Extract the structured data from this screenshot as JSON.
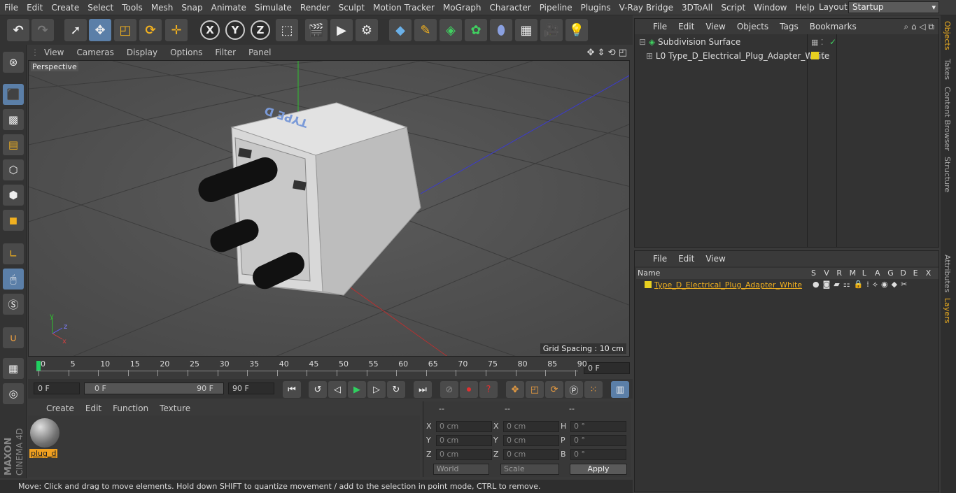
{
  "menubar": {
    "items": [
      "File",
      "Edit",
      "Create",
      "Select",
      "Tools",
      "Mesh",
      "Snap",
      "Animate",
      "Simulate",
      "Render",
      "Sculpt",
      "Motion Tracker",
      "MoGraph",
      "Character",
      "Pipeline",
      "Plugins",
      "V-Ray Bridge",
      "3DToAll",
      "Script",
      "Window",
      "Help"
    ],
    "layout_label": "Layout:",
    "layout_value": "Startup"
  },
  "toolbar": {
    "x_label": "X",
    "y_label": "Y",
    "z_label": "Z"
  },
  "viewport": {
    "menu": [
      "View",
      "Cameras",
      "Display",
      "Options",
      "Filter",
      "Panel"
    ],
    "camera_label": "Perspective",
    "grid_spacing": "Grid Spacing : 10 cm",
    "model_text": "TYPE D",
    "axis_x": "x",
    "axis_y": "y",
    "axis_z": "z"
  },
  "timeline": {
    "ticks": [
      "0",
      "5",
      "10",
      "15",
      "20",
      "25",
      "30",
      "35",
      "40",
      "45",
      "50",
      "55",
      "60",
      "65",
      "70",
      "75",
      "80",
      "85",
      "90"
    ],
    "current_frame": "0 F"
  },
  "transport": {
    "start": "0 F",
    "range_start": "0 F",
    "range_end": "90 F",
    "end": "90 F"
  },
  "material_manager": {
    "menu": [
      "Create",
      "Edit",
      "Function",
      "Texture"
    ],
    "material_name": "plug_d"
  },
  "coordinates": {
    "header": [
      "--",
      "--",
      "--"
    ],
    "rows": [
      {
        "l1": "X",
        "v1": "0 cm",
        "l2": "X",
        "v2": "0 cm",
        "l3": "H",
        "v3": "0 °"
      },
      {
        "l1": "Y",
        "v1": "0 cm",
        "l2": "Y",
        "v2": "0 cm",
        "l3": "P",
        "v3": "0 °"
      },
      {
        "l1": "Z",
        "v1": "0 cm",
        "l2": "Z",
        "v2": "0 cm",
        "l3": "B",
        "v3": "0 °"
      }
    ],
    "mode": "World",
    "scale": "Scale",
    "apply": "Apply"
  },
  "status": "Move: Click and drag to move elements. Hold down SHIFT to quantize movement / add to the selection in point mode, CTRL to remove.",
  "object_manager": {
    "menu": [
      "File",
      "Edit",
      "View",
      "Objects",
      "Tags",
      "Bookmarks"
    ],
    "objects": [
      "Subdivision Surface",
      "Type_D_Electrical_Plug_Adapter_White"
    ]
  },
  "layer_manager": {
    "menu": [
      "File",
      "Edit",
      "View"
    ],
    "col_name": "Name",
    "cols": [
      "S",
      "V",
      "R",
      "M",
      "L",
      "A",
      "G",
      "D",
      "E",
      "X"
    ],
    "layer": "Type_D_Electrical_Plug_Adapter_White"
  },
  "right_tabs": [
    "Objects",
    "Takes",
    "Content Browser",
    "Structure",
    "Attributes",
    "Layers"
  ],
  "brand": {
    "maxon": "MAXON",
    "product": "CINEMA 4D"
  },
  "colors": {
    "accent": "#f0b020",
    "active_blue": "#5b7fa8",
    "layer_yellow": "#e8d020"
  }
}
